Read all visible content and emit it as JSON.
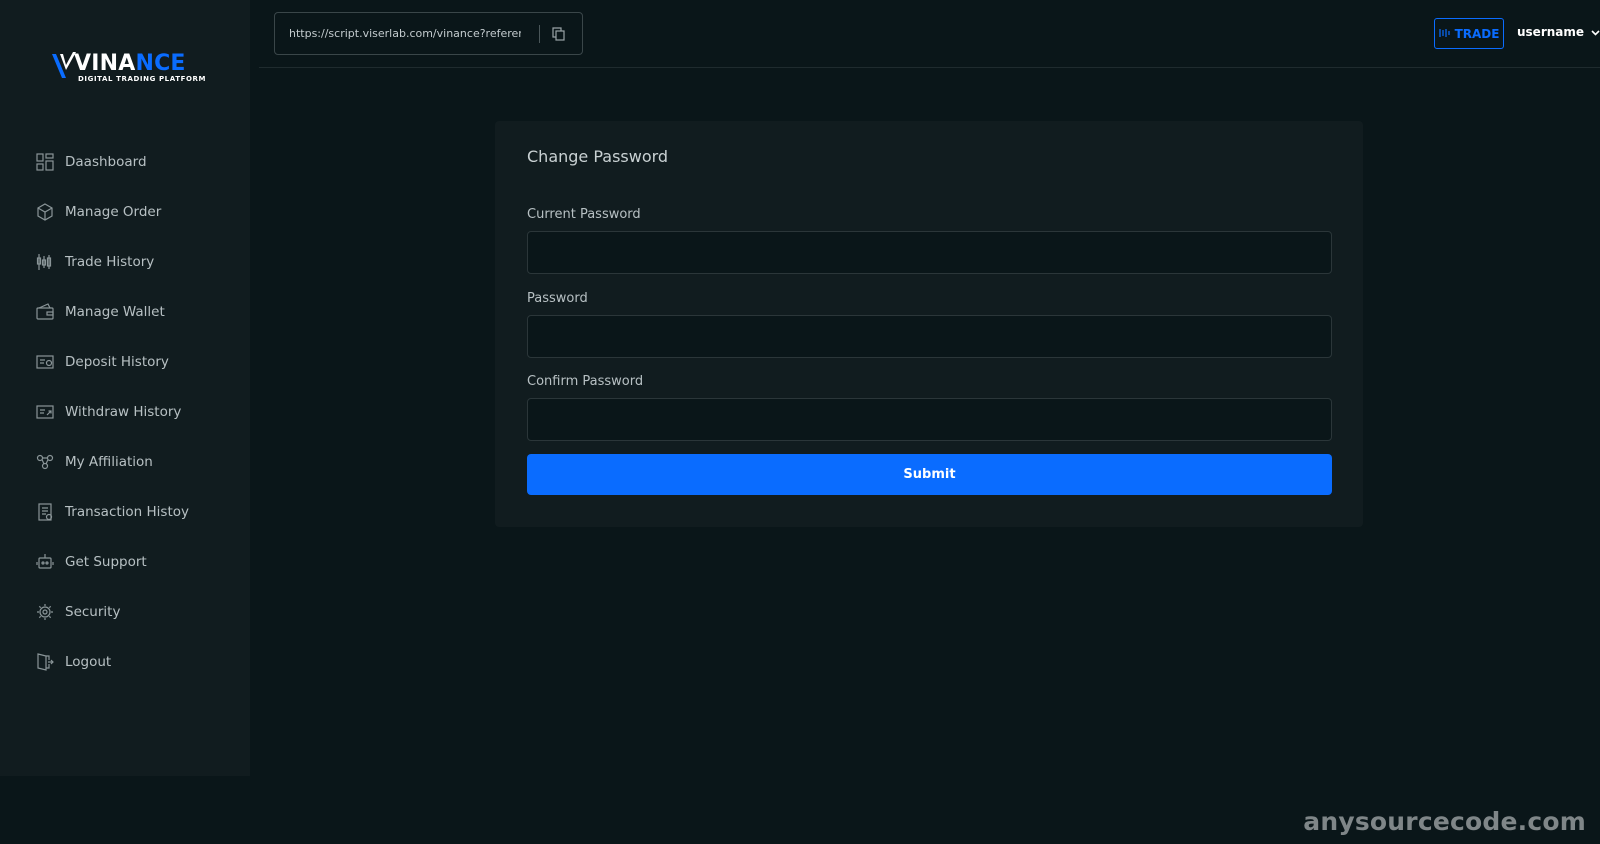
{
  "brand": {
    "name_part1": "VINA",
    "name_part2": "NCE",
    "tagline": "DIGITAL TRADING PLATFORM",
    "accent_color": "#0a6cff"
  },
  "sidebar": {
    "items": [
      {
        "label": "Daashboard",
        "icon": "dashboard-icon"
      },
      {
        "label": "Manage Order",
        "icon": "cube-icon"
      },
      {
        "label": "Trade History",
        "icon": "candlestick-icon"
      },
      {
        "label": "Manage Wallet",
        "icon": "wallet-icon"
      },
      {
        "label": "Deposit History",
        "icon": "deposit-icon"
      },
      {
        "label": "Withdraw History",
        "icon": "withdraw-icon"
      },
      {
        "label": "My Affiliation",
        "icon": "affiliation-icon"
      },
      {
        "label": "Transaction Histoy",
        "icon": "transaction-icon"
      },
      {
        "label": "Get Support",
        "icon": "support-icon"
      },
      {
        "label": "Security",
        "icon": "security-icon"
      },
      {
        "label": "Logout",
        "icon": "logout-icon"
      }
    ]
  },
  "header": {
    "referral_url": "https://script.viserlab.com/vinance?referen",
    "copy_icon": "copy-icon",
    "trade_label": "TRADE",
    "username": "username"
  },
  "form": {
    "title": "Change Password",
    "current_password_label": "Current Password",
    "password_label": "Password",
    "confirm_password_label": "Confirm Password",
    "submit_label": "Submit"
  },
  "watermark": "anysourcecode.com"
}
